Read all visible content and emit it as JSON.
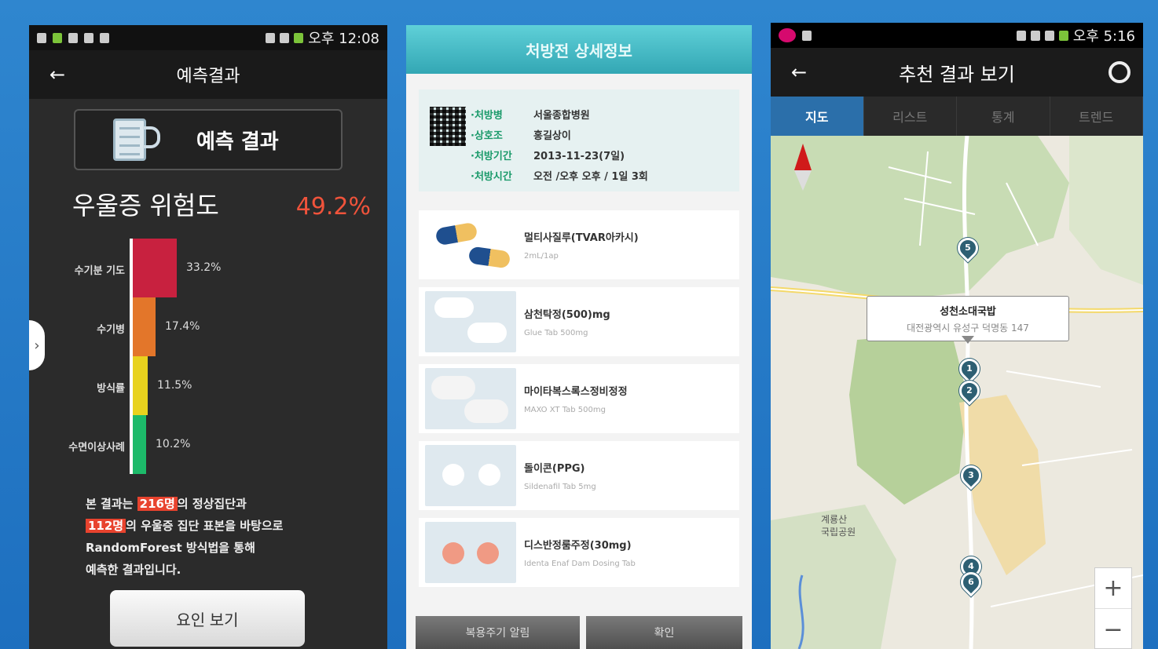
{
  "phone1": {
    "status_time": "오후 12:08",
    "title": "예측결과",
    "header_label": "예측 결과",
    "risk_label": "우울증 위험도",
    "risk_value": "49.2%",
    "bars": [
      {
        "label": "수기분 기도",
        "value": 33.2,
        "value_text": "33.2%",
        "color": "#c8213f"
      },
      {
        "label": "수기병",
        "value": 17.4,
        "value_text": "17.4%",
        "color": "#e3762a"
      },
      {
        "label": "방식률",
        "value": 11.5,
        "value_text": "11.5%",
        "color": "#e8d21e"
      },
      {
        "label": "수면이상사례",
        "value": 10.2,
        "value_text": "10.2%",
        "color": "#1dba6a"
      }
    ],
    "note_part1": "본 결과는",
    "note_hl1": "216명",
    "note_part2": "의 정상집단과",
    "note_hl2": "112명",
    "note_part3": "의 우울증 집단 표본을 바탕으로",
    "note_part4": "RandomForest 방식법을 통해",
    "note_part5": "예측한 결과입니다.",
    "button_label": "요인 보기",
    "side_tab_icon": "›"
  },
  "phone2": {
    "title": "처방전 상세정보",
    "info": [
      {
        "k": "·처방병",
        "v": "서울종합병원"
      },
      {
        "k": "·상호조",
        "v": "홍길상이"
      },
      {
        "k": "·처방기간",
        "v": "2013-11-23(7일)"
      },
      {
        "k": "·처방시간",
        "v": "오전 /오후 오후 /  1일 3회"
      }
    ],
    "drugs": [
      {
        "name": "멀티사질루(TVAR아카시)",
        "sub": "2mL/1ap"
      },
      {
        "name": "삼천탁정(500)mg",
        "sub": "Glue Tab 500mg"
      },
      {
        "name": "마이타복스록스정비정정",
        "sub": "MAXO XT Tab 500mg"
      },
      {
        "name": "돌이콘(PPG)",
        "sub": "Sildenafil Tab 5mg"
      },
      {
        "name": "디스반정룸주정(30mg)",
        "sub": "Identa Enaf Dam Dosing Tab"
      }
    ],
    "btn_left": "복용주기 알림",
    "btn_right": "확인"
  },
  "phone3": {
    "status_time": "오후 5:16",
    "title": "추천 결과 보기",
    "tabs": [
      "지도",
      "리스트",
      "통계",
      "트렌드"
    ],
    "popup_title": "성천소대국밥",
    "popup_addr": "대전광역시 유성구 덕명동 147",
    "markers": [
      "1",
      "2",
      "3",
      "5",
      "4",
      "6"
    ],
    "area_label1": "계룡산",
    "area_label2": "국립공원",
    "zoom_in": "+",
    "zoom_out": "−"
  }
}
